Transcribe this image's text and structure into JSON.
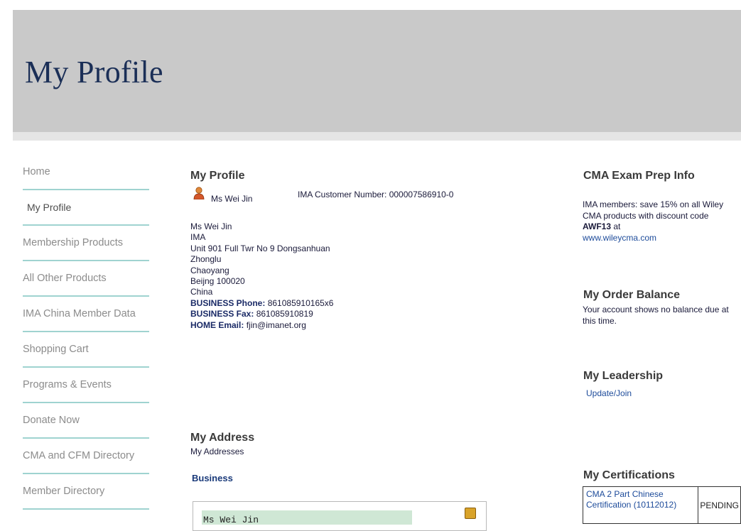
{
  "header": {
    "title": "My Profile"
  },
  "sidebar": {
    "items": [
      {
        "label": "Home"
      },
      {
        "label": "My Profile"
      },
      {
        "label": "Membership Products"
      },
      {
        "label": "All Other Products"
      },
      {
        "label": "IMA China Member Data"
      },
      {
        "label": "Shopping Cart"
      },
      {
        "label": "Programs & Events"
      },
      {
        "label": "Donate Now"
      },
      {
        "label": "CMA and CFM Directory"
      },
      {
        "label": "Member Directory"
      }
    ]
  },
  "profile": {
    "section_title": "My Profile",
    "display_name": "Ms Wei Jin",
    "customer_number": "IMA Customer Number: 000007586910-0",
    "address_lines": [
      "Ms Wei Jin",
      "IMA",
      "Unit 901 Full Twr No 9 Dongsanhuan",
      "Zhonglu",
      "Chaoyang",
      "Beijng 100020",
      "China"
    ],
    "business_phone_label": "BUSINESS Phone:",
    "business_phone": "861085910165x6",
    "business_fax_label": "BUSINESS Fax:",
    "business_fax": "861085910819",
    "home_email_label": "HOME Email:",
    "home_email": "fjin@imanet.org"
  },
  "address": {
    "section_title": "My Address",
    "link": "My Addresses",
    "type_label": "Business",
    "card_name": "Ms Wei Jin"
  },
  "cma_prep": {
    "title": "CMA Exam Prep Info",
    "text_before": "IMA members: save 15% on all Wiley CMA products with discount code ",
    "code": "AWF13",
    "text_after": " at",
    "link": "www.wileycma.com"
  },
  "order_balance": {
    "title": "My Order Balance",
    "text": "Your account shows no balance due at this time."
  },
  "leadership": {
    "title": "My Leadership",
    "link": "Update/Join"
  },
  "certifications": {
    "title": "My Certifications",
    "rows": [
      {
        "name": "CMA 2 Part Chinese Certification (10112012)",
        "status": "PENDING"
      }
    ]
  },
  "colors": {
    "banner_bg": "#c9c9c9",
    "banner_title": "#1b2f57",
    "nav_divider": "#9fd3d0",
    "link": "#1d4b9a",
    "address_highlight": "#cfe7d5"
  },
  "icons": {
    "person": "person-icon",
    "edit": "edit-icon"
  }
}
